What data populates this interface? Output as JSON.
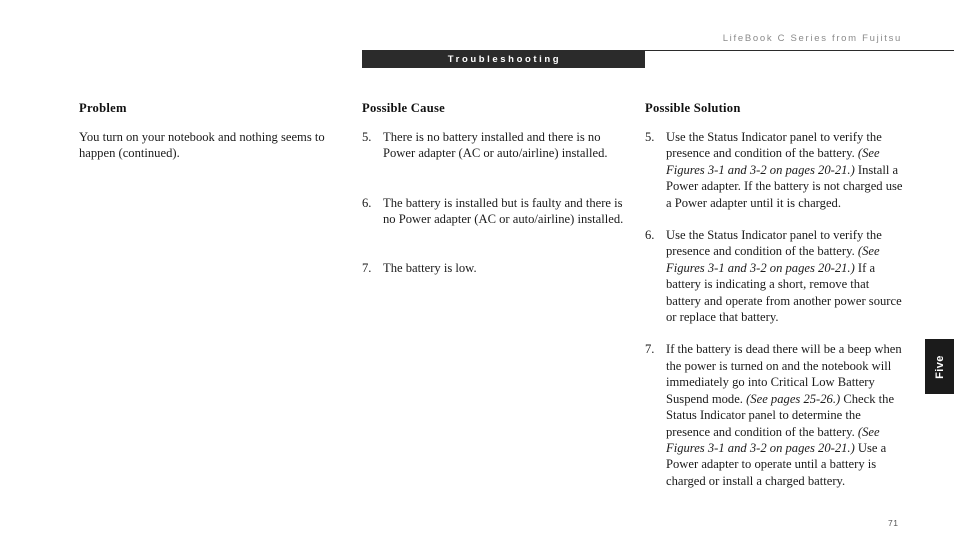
{
  "header": {
    "running_head": "LifeBook C Series from Fujitsu",
    "section_banner": "Troubleshooting"
  },
  "columns": {
    "problem": {
      "title": "Problem",
      "text": "You turn on your notebook and nothing seems to happen (continued)."
    },
    "cause": {
      "title": "Possible Cause",
      "items": [
        {
          "number": "5.",
          "text": "There is no battery installed and there is no Power adapter (AC or auto/airline) installed."
        },
        {
          "number": "6.",
          "text": "The battery is installed but is faulty and there is no Power adapter (AC or auto/airline) installed."
        },
        {
          "number": "7.",
          "text": "The battery is low."
        }
      ]
    },
    "solution": {
      "title": "Possible Solution",
      "items": [
        {
          "number": "5.",
          "parts": [
            {
              "style": "normal",
              "text": "Use the Status Indicator panel to verify the presence and condition of the battery. "
            },
            {
              "style": "italic",
              "text": "(See Figures 3-1 and 3-2 on pages 20-21.)"
            },
            {
              "style": "normal",
              "text": " Install a Power adapter. If the battery is not charged use a Power adapter until it is charged."
            }
          ]
        },
        {
          "number": "6.",
          "parts": [
            {
              "style": "normal",
              "text": "Use the Status Indicator panel to verify the presence and condition of the battery. "
            },
            {
              "style": "italic",
              "text": "(See Figures 3-1 and 3-2 on pages 20-21.)"
            },
            {
              "style": "normal",
              "text": " If a battery is indicating a short, remove that battery and operate from another power source or replace that battery."
            }
          ]
        },
        {
          "number": "7.",
          "parts": [
            {
              "style": "normal",
              "text": "If the battery is dead there will be a beep when the power is turned on and the notebook will immediately go into Critical Low Battery Suspend mode. "
            },
            {
              "style": "italic",
              "text": "(See pages 25-26.)"
            },
            {
              "style": "normal",
              "text": " Check the Status Indicator panel to determine the presence and condition of the battery. "
            },
            {
              "style": "italic",
              "text": "(See Figures 3-1 and 3-2 on pages 20-21.)"
            },
            {
              "style": "normal",
              "text": "  Use a Power adapter to operate until a battery is charged or install a charged battery."
            }
          ]
        }
      ]
    }
  },
  "chapter_tab": {
    "label": "Five"
  },
  "folio": {
    "page_number": "71"
  }
}
